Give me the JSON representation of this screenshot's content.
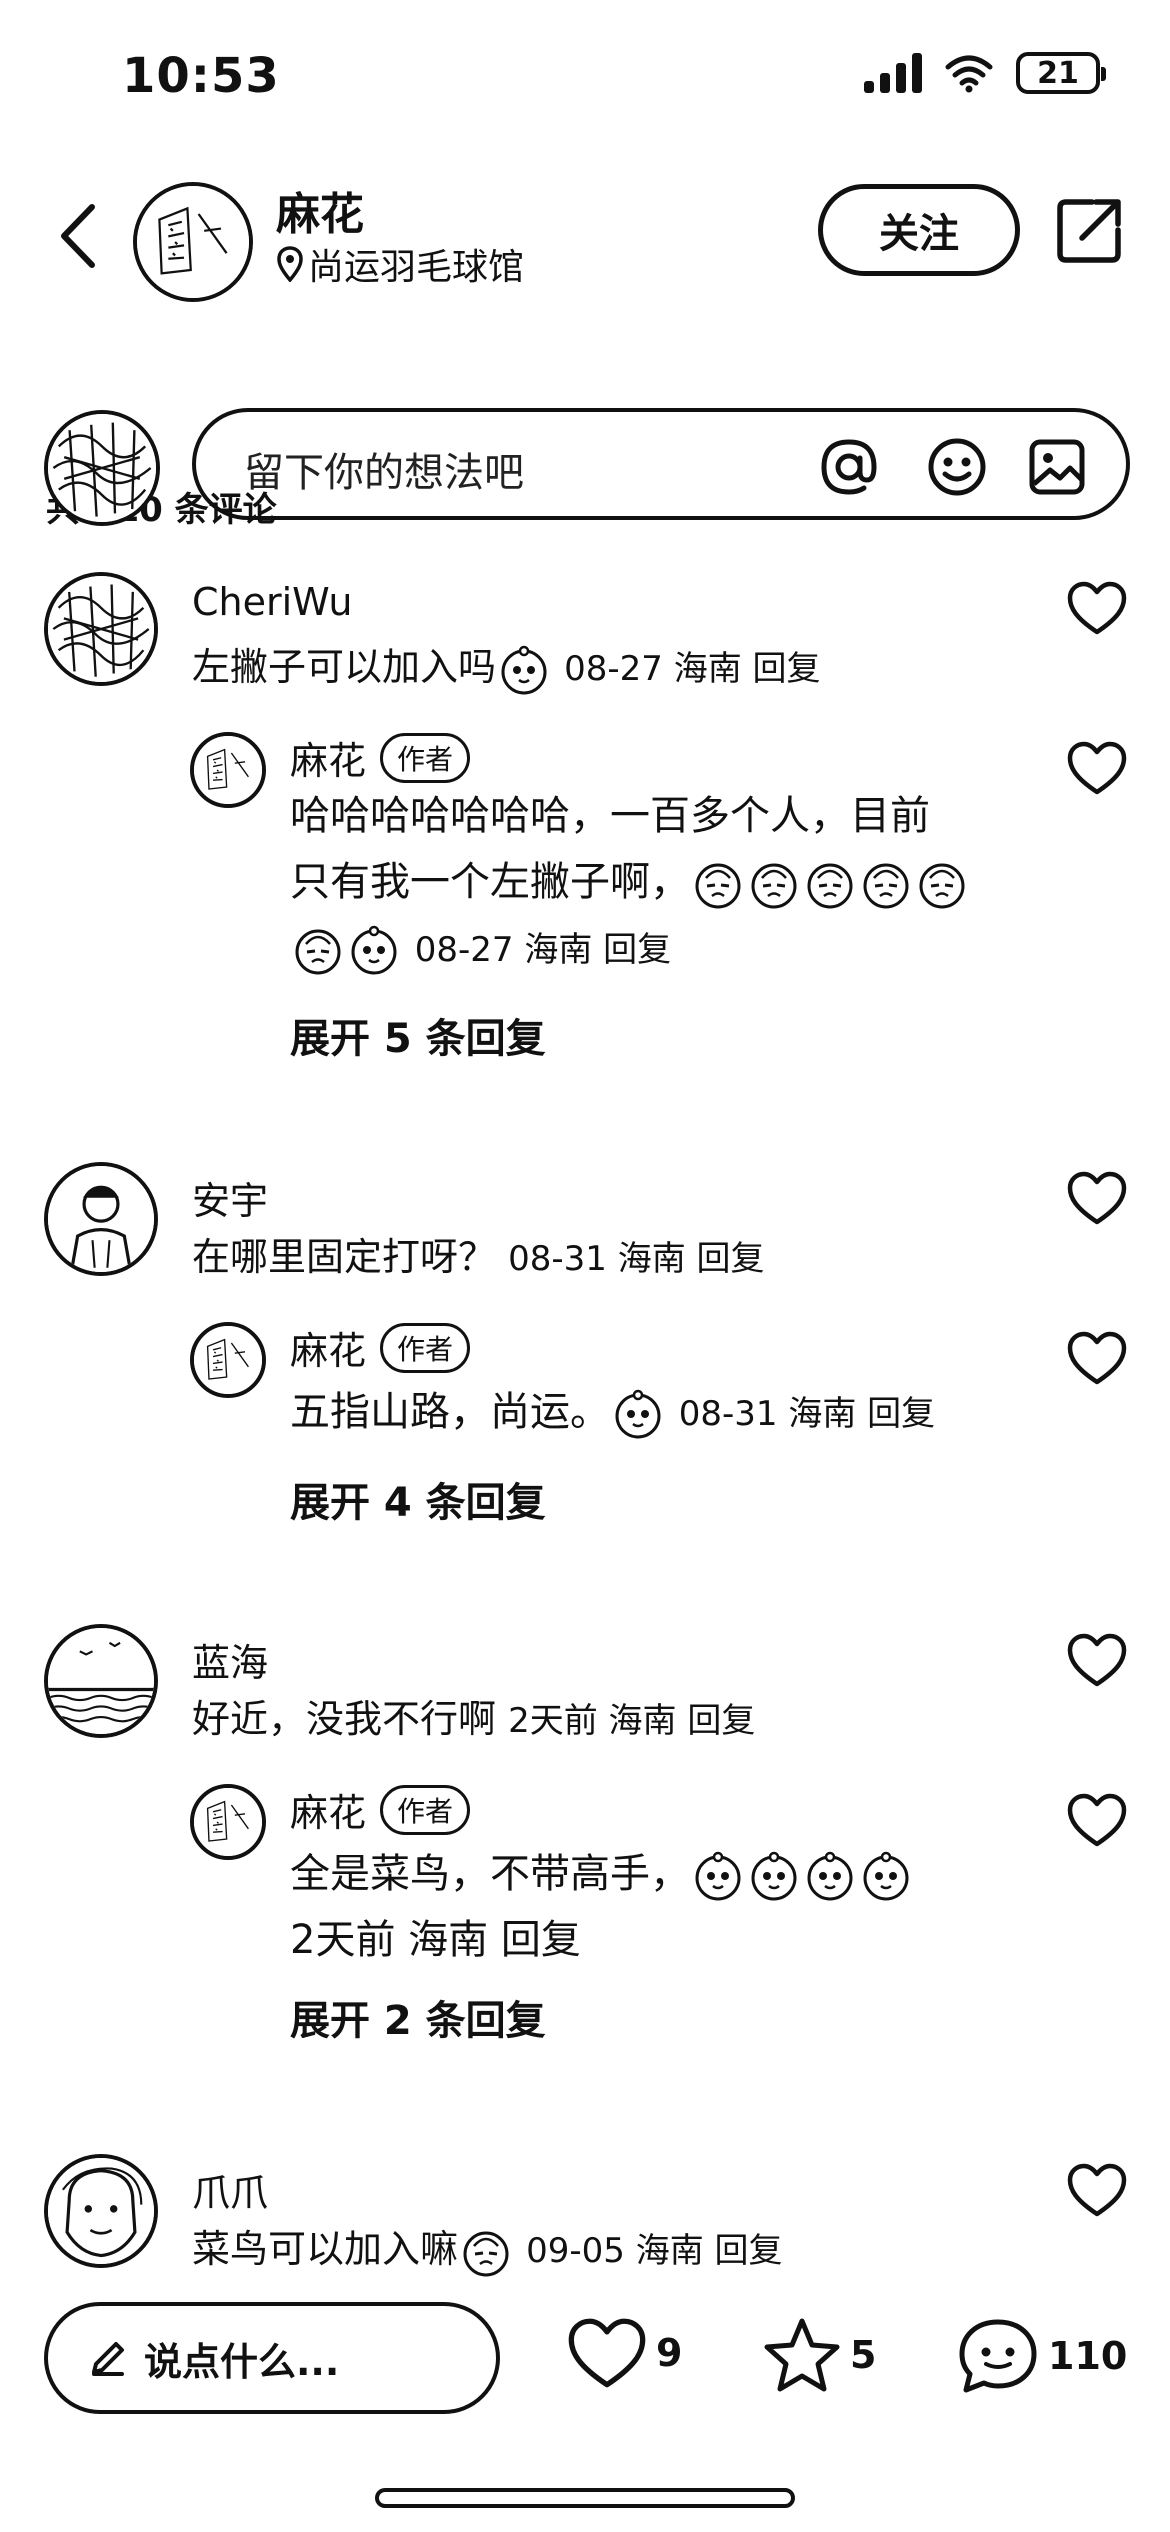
{
  "status_bar": {
    "time": "10:53",
    "battery": "21"
  },
  "header": {
    "name": "麻花",
    "location": "尚运羽毛球馆",
    "follow_label": "关注"
  },
  "comment_count": "共 110 条评论",
  "input": {
    "placeholder": "留下你的想法吧"
  },
  "comments": [
    {
      "name": "CheriWu",
      "text": "左撇子可以加入吗",
      "meta": "08-27 海南 回复",
      "reply": {
        "name": "麻花",
        "badge": "作者",
        "line1": "哈哈哈哈哈哈哈，一百多个人，目前",
        "line2": "只有我一个左撇子啊，",
        "meta": "08-27 海南 回复",
        "expand": "展开 5 条回复"
      }
    },
    {
      "name": "安宇",
      "text": "在哪里固定打呀？",
      "meta": "08-31 海南 回复",
      "reply": {
        "name": "麻花",
        "badge": "作者",
        "line1": "五指山路，尚运。",
        "meta": "08-31 海南 回复",
        "expand": "展开 4 条回复"
      }
    },
    {
      "name": "蓝海",
      "text": "好近，没我不行啊",
      "meta": "2天前 海南 回复",
      "reply": {
        "name": "麻花",
        "badge": "作者",
        "line1": "全是菜鸟，不带高手，",
        "meta": "2天前 海南 回复",
        "expand": "展开 2 条回复"
      }
    },
    {
      "name": "爪爪",
      "text": "菜鸟可以加入嘛",
      "meta": "09-05 海南 回复"
    }
  ],
  "bottom_bar": {
    "say_placeholder": "说点什么...",
    "likes": "9",
    "stars": "5",
    "comments": "110"
  }
}
